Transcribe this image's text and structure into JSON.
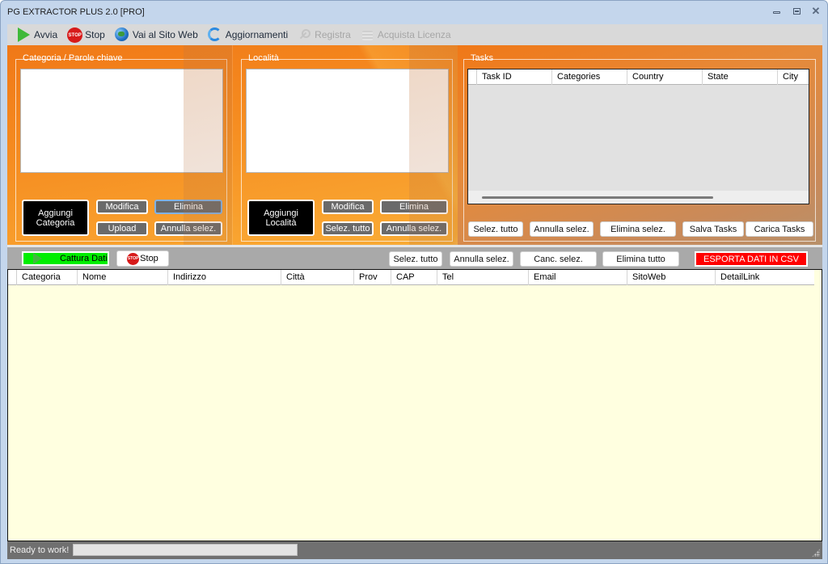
{
  "window": {
    "title": "PG EXTRACTOR PLUS 2.0 [PRO]",
    "controls": {
      "minimize": "minimize",
      "maximize": "maximize",
      "close": "close"
    }
  },
  "toolbar": {
    "items": [
      {
        "label": "Avvia",
        "icon": "play-icon",
        "enabled": true
      },
      {
        "label": "Stop",
        "icon": "stop-icon",
        "enabled": true,
        "icon_text": "STOP"
      },
      {
        "label": "Vai al Sito Web",
        "icon": "globe-icon",
        "enabled": true
      },
      {
        "label": "Aggiornamenti",
        "icon": "refresh-icon",
        "enabled": true
      },
      {
        "label": "Registra",
        "icon": "key-icon",
        "enabled": false
      },
      {
        "label": "Acquista Licenza",
        "icon": "coins-icon",
        "enabled": false
      }
    ]
  },
  "categories": {
    "legend": "Categoria / Parole chiave",
    "items": [],
    "buttons": {
      "add": "Aggiungi\nCategoria",
      "add_line1": "Aggiungi",
      "add_line2": "Categoria",
      "edit": "Modifica",
      "delete": "Elimina",
      "upload": "Upload",
      "deselect": "Annulla selez."
    }
  },
  "locations": {
    "legend": "Località",
    "items": [],
    "buttons": {
      "add_line1": "Aggiungi",
      "add_line2": "Località",
      "edit": "Modifica",
      "delete": "Elimina",
      "select_all": "Selez. tutto",
      "deselect": "Annulla selez."
    }
  },
  "tasks": {
    "legend": "Tasks",
    "columns": [
      "Task ID",
      "Categories",
      "Country",
      "State",
      "City"
    ],
    "rows": [],
    "buttons": {
      "select_all": "Selez. tutto",
      "deselect": "Annulla selez.",
      "delete_selected": "Elimina selez.",
      "save": "Salva Tasks",
      "load": "Carica Tasks"
    }
  },
  "actions": {
    "capture": "Cattura Dati",
    "stop": "Stop",
    "stop_icon_text": "STOP",
    "select_all": "Selez. tutto",
    "deselect": "Annulla selez.",
    "cancel_selected": "Canc. selez.",
    "delete_all": "Elimina tutto",
    "export_csv": "ESPORTA DATI IN CSV",
    "colors": {
      "capture": "#00ee00",
      "export": "#ff0000"
    }
  },
  "results": {
    "columns": [
      "Categoria",
      "Nome",
      "Indirizzo",
      "Città",
      "Prov",
      "CAP",
      "Tel",
      "Email",
      "SitoWeb",
      "DetailLink"
    ],
    "rows": []
  },
  "status": {
    "text": "Ready to work!",
    "progress_percent": 0
  }
}
